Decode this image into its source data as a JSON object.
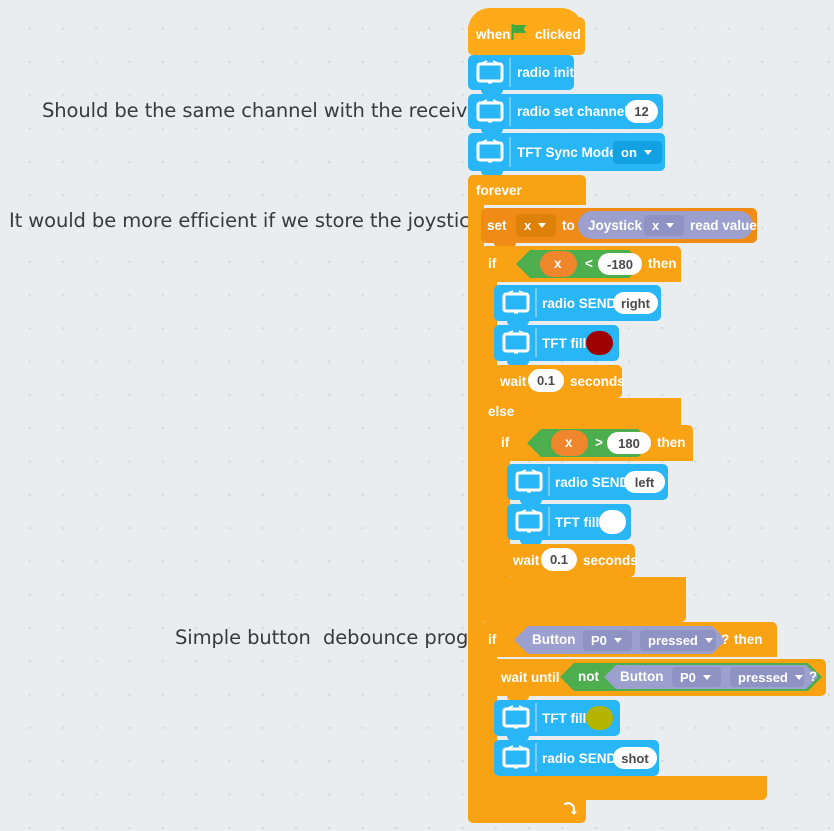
{
  "page": {
    "background_color": "#e9edf0",
    "grid": "dotted"
  },
  "annotations": [
    {
      "id": "note-channel",
      "text": "Should be the same channel with the receiving end"
    },
    {
      "id": "note-joystick",
      "text": "It would be more efficient if we store the joystick value"
    },
    {
      "id": "note-debounce",
      "text": "Simple button  debounce program"
    }
  ],
  "palette": {
    "events_hat": "#ffab19",
    "control_orange": "#f9a214",
    "variables_orange": "#f08c15",
    "radio_blue": "#29b6f6",
    "operators_green": "#4cae4c",
    "sensing_purple": "#9ba0cf",
    "white": "#ffffff",
    "fill_red": "#9f0000",
    "fill_white": "#ffffff",
    "fill_olive": "#b3b300",
    "flag_green": "#3dab3d"
  },
  "script": {
    "hat": {
      "prefix": "when",
      "icon": "green-flag-icon",
      "suffix": "clicked"
    },
    "blocks": {
      "radio_init": {
        "label": "radio init",
        "icon": "radio-tv-icon"
      },
      "radio_set_channel": {
        "label": "radio set channel",
        "value": "12",
        "icon": "radio-tv-icon"
      },
      "tft_sync_mode": {
        "label": "TFT Sync Mode",
        "option": "on",
        "icon": "radio-tv-icon"
      },
      "forever": {
        "label": "forever",
        "loop_icon": "loop-arrow-icon"
      },
      "set_var": {
        "label": "set",
        "variable": "x",
        "to": "to",
        "reporter": {
          "source": "Joystick",
          "axis": "x",
          "action": "read value"
        }
      },
      "if_1": {
        "keyword": "if",
        "then": "then",
        "condition": {
          "left": "x",
          "operator": "<",
          "right": "-180"
        }
      },
      "radio_send_right": {
        "label": "radio SEND",
        "value": "right",
        "icon": "radio-tv-icon"
      },
      "tft_fill_red": {
        "label": "TFT fill",
        "color": "#9f0000",
        "icon": "radio-tv-icon"
      },
      "wait_1": {
        "label": "wait",
        "value": "0.1",
        "unit": "seconds"
      },
      "else_1": {
        "label": "else"
      },
      "if_2": {
        "keyword": "if",
        "then": "then",
        "condition": {
          "left": "x",
          "operator": ">",
          "right": "180"
        }
      },
      "radio_send_left": {
        "label": "radio SEND",
        "value": "left",
        "icon": "radio-tv-icon"
      },
      "tft_fill_white": {
        "label": "TFT fill",
        "color": "#ffffff",
        "icon": "radio-tv-icon"
      },
      "wait_2": {
        "label": "wait",
        "value": "0.1",
        "unit": "seconds"
      },
      "if_3": {
        "keyword": "if",
        "then": "then",
        "condition": {
          "subject": "Button",
          "pin": "P0",
          "state": "pressed",
          "query": "?"
        }
      },
      "wait_until": {
        "label": "wait until",
        "not": "not",
        "condition": {
          "subject": "Button",
          "pin": "P0",
          "state": "pressed",
          "query": "?"
        }
      },
      "tft_fill_olive": {
        "label": "TFT fill",
        "color": "#b3b300",
        "icon": "radio-tv-icon"
      },
      "radio_send_shot": {
        "label": "radio SEND",
        "value": "shot",
        "icon": "radio-tv-icon"
      }
    }
  }
}
